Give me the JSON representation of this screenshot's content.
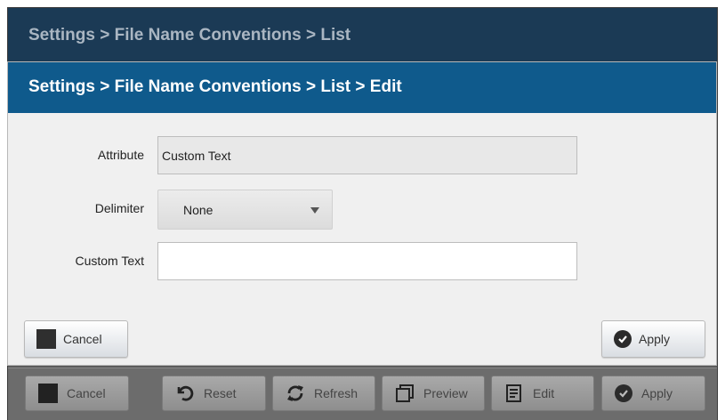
{
  "outer": {
    "breadcrumb": "Settings > File Name Conventions > List"
  },
  "dialog": {
    "breadcrumb": "Settings > File Name Conventions > List > Edit",
    "fields": {
      "attribute": {
        "label": "Attribute",
        "value": "Custom Text"
      },
      "delimiter": {
        "label": "Delimiter",
        "value": "None"
      },
      "custom_text": {
        "label": "Custom Text",
        "value": "",
        "placeholder": ""
      }
    },
    "buttons": {
      "cancel": "Cancel",
      "apply": "Apply"
    }
  },
  "toolbar": {
    "cancel": "Cancel",
    "reset": "Reset",
    "refresh": "Refresh",
    "preview": "Preview",
    "edit": "Edit",
    "apply": "Apply"
  },
  "icons": {
    "cancel": "stop-square-icon",
    "reset": "reset-icon",
    "refresh": "refresh-icon",
    "preview": "preview-icon",
    "edit": "edit-icon",
    "apply": "check-circle-icon"
  },
  "colors": {
    "outer_header": "#1b3a55",
    "dialog_header": "#0f5a8c",
    "dialog_bg": "#f0f0f0",
    "toolbar_bg": "#6c6c6c"
  }
}
